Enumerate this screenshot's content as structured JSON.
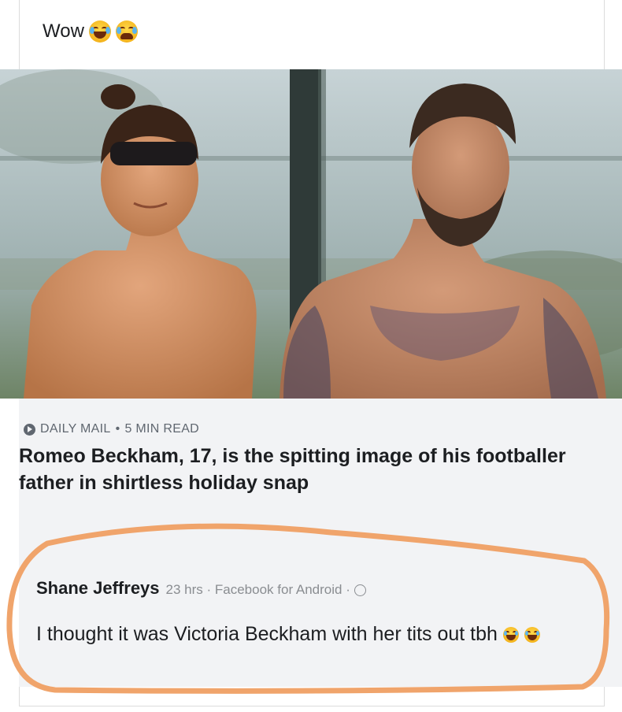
{
  "post": {
    "text": "Wow",
    "emojis": [
      "laughing-crying-emoji-icon",
      "crying-emoji-icon"
    ]
  },
  "article": {
    "source": "DAILY MAIL",
    "separator": "•",
    "read_time": "5 MIN READ",
    "headline": "Romeo Beckham, 17, is the spitting image of his footballer father in shirtless holiday snap"
  },
  "comment": {
    "author": "Shane Jeffreys",
    "meta": "23 hrs · Facebook for Android ·",
    "text": "I thought it was Victoria Beckham with her tits out tbh",
    "emojis": [
      "laughing-crying-emoji-icon",
      "laughing-crying-emoji-icon"
    ]
  },
  "colors": {
    "highlight_circle": "#f0a46b",
    "comment_background": "#f2f3f5",
    "secondary_text": "#606770"
  }
}
